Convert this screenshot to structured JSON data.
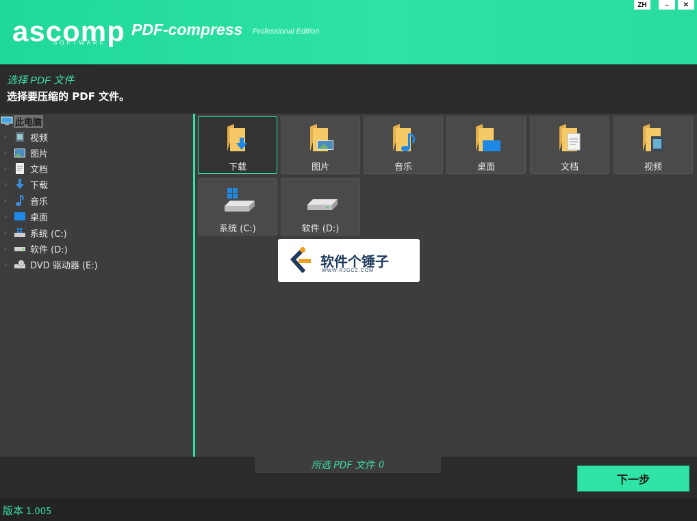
{
  "header": {
    "logo": "ascomp",
    "logo_sub": "SOFTWARE",
    "app_title": "PDF-compress",
    "edition": "Professional Edition",
    "language": "ZH",
    "minimize": "–",
    "close": "✕"
  },
  "step": {
    "title": "选择 PDF 文件",
    "description": "选择要压缩的 PDF 文件。"
  },
  "tree": {
    "root": "此电脑",
    "items": [
      {
        "label": "视频",
        "icon": "video-icon"
      },
      {
        "label": "图片",
        "icon": "picture-icon"
      },
      {
        "label": "文档",
        "icon": "document-icon"
      },
      {
        "label": "下载",
        "icon": "download-icon"
      },
      {
        "label": "音乐",
        "icon": "music-icon"
      },
      {
        "label": "桌面",
        "icon": "desktop-icon"
      },
      {
        "label": "系统 (C:)",
        "icon": "system-drive-icon"
      },
      {
        "label": "软件 (D:)",
        "icon": "drive-icon"
      },
      {
        "label": "DVD 驱动器 (E:)",
        "icon": "dvd-drive-icon"
      }
    ]
  },
  "tiles": [
    {
      "label": "下载",
      "icon": "download-folder-icon",
      "selected": true
    },
    {
      "label": "图片",
      "icon": "pictures-folder-icon"
    },
    {
      "label": "音乐",
      "icon": "music-folder-icon"
    },
    {
      "label": "桌面",
      "icon": "desktop-folder-icon"
    },
    {
      "label": "文档",
      "icon": "documents-folder-icon"
    },
    {
      "label": "视频",
      "icon": "videos-folder-icon"
    },
    {
      "label": "系统 (C:)",
      "icon": "system-drive-icon"
    },
    {
      "label": "软件 (D:)",
      "icon": "drive-icon"
    }
  ],
  "watermark": {
    "text": "软件个锤子",
    "url": "WWW.RJGCZ.COM"
  },
  "bottom": {
    "selected_label": "所选 PDF 文件",
    "selected_count": "0",
    "next_label": "下一步"
  },
  "status": {
    "version_label": "版本",
    "version_number": "1.005"
  },
  "colors": {
    "accent": "#2ee3a3",
    "panel": "#3d3d3d",
    "background": "#2b2b2b"
  }
}
